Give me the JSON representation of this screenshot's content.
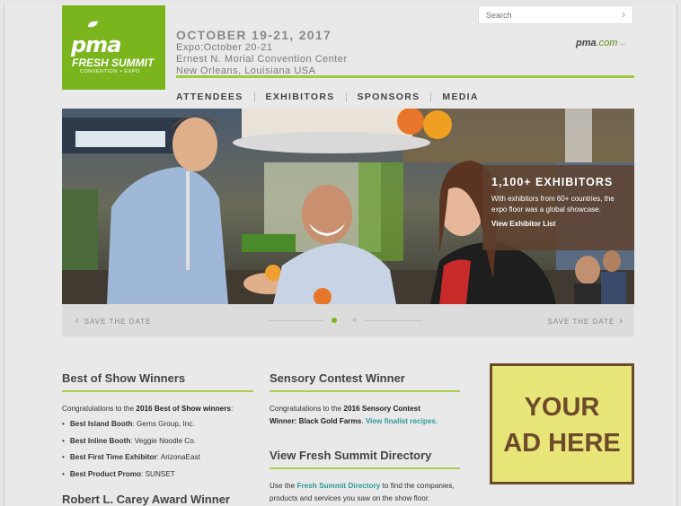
{
  "logo": {
    "brand": "pma",
    "line1": "FRESH SUMMIT",
    "line2": "CONVENTION + EXPO"
  },
  "event": {
    "date": "OCTOBER 19-21, 2017",
    "expo": "Expo:October 20-21",
    "venue": "Ernest N. Morial Convention Center",
    "city": "New Orleans, Louisiana USA"
  },
  "search": {
    "placeholder": "Search"
  },
  "site_link": {
    "brand": "pma",
    "domain": ".com"
  },
  "nav": [
    "ATTENDEES",
    "EXHIBITORS",
    "SPONSORS",
    "MEDIA"
  ],
  "hero": {
    "promo_title": "1,100+ EXHIBITORS",
    "promo_desc": "With exhibitors from 60+ countries, the expo floor was a global showcase.",
    "promo_link": "View Exhibitor List"
  },
  "slider": {
    "prev": "SAVE THE DATE",
    "next": "SAVE THE DATE",
    "active_index": 0,
    "count": 2
  },
  "best_of_show": {
    "title": "Best of Show Winners",
    "intro_pre": "Congratulations to the ",
    "intro_bold": "2016 Best of Show winners",
    "intro_post": ":",
    "items": [
      {
        "label": "Best Island Booth",
        "value": ": Gems Group, Inc."
      },
      {
        "label": "Best Inline Booth",
        "value": ": Veggie Noodle Co."
      },
      {
        "label": "Best First Time Exhibitor",
        "value": ": ArizonaEast"
      },
      {
        "label": "Best Product Promo",
        "value": ": SUNSET"
      }
    ]
  },
  "carey_award": {
    "title": "Robert L. Carey Award Winner"
  },
  "sensory": {
    "title": "Sensory Contest Winner",
    "pre": "Congratulations to the ",
    "bold1": "2016 Sensory Contest",
    "bold2": "Winner: Black Gold Farms",
    "post": ". ",
    "link": "View finalist recipes."
  },
  "directory": {
    "title": "View Fresh Summit Directory",
    "pre": "Use the ",
    "link": "Fresh Summit Directory",
    "post1": " to find the companies,",
    "post2": "products and services you saw on the show floor."
  },
  "ad": {
    "line1": "YOUR",
    "line2": "AD HERE"
  },
  "colors": {
    "brand_green": "#7ab51d",
    "rule_green": "#a8d04a",
    "promo_brown": "#5f412d",
    "link_teal": "#2d9a9a",
    "ad_yellow": "#e8e579",
    "ad_brown": "#6d4a2a"
  }
}
